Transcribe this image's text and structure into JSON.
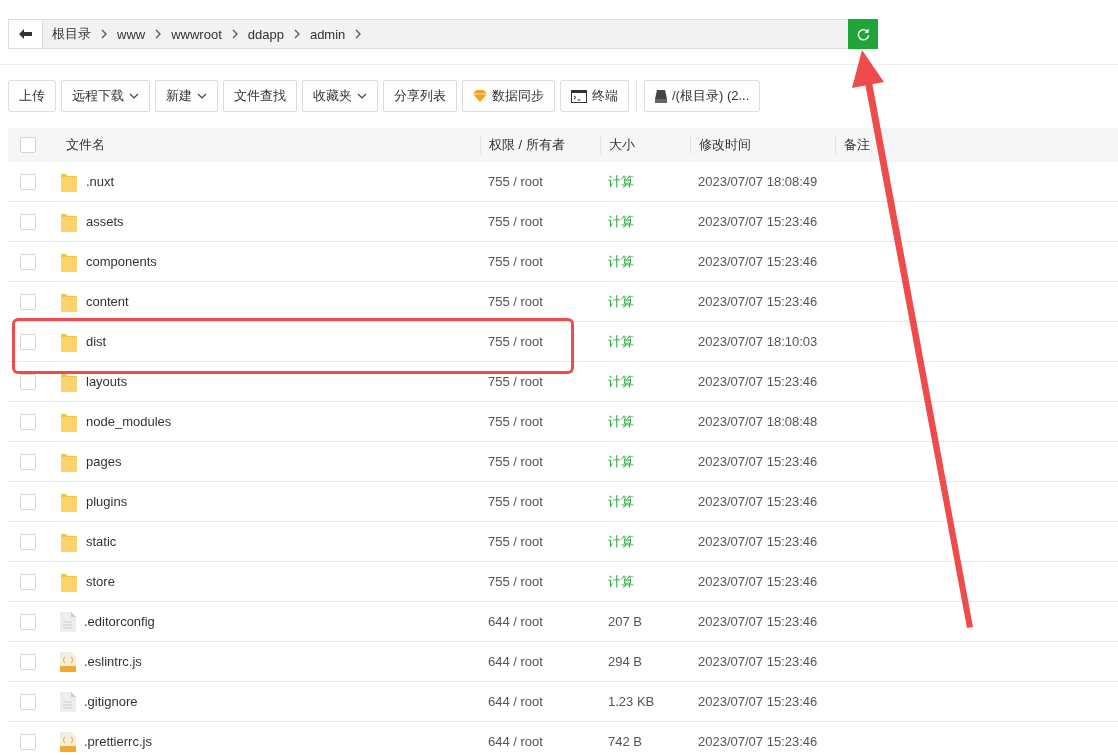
{
  "breadcrumb": {
    "items": [
      "根目录",
      "www",
      "wwwroot",
      "ddapp",
      "admin"
    ]
  },
  "toolbar": [
    {
      "kind": "plain",
      "label": "上传"
    },
    {
      "kind": "dropdown",
      "label": "远程下载"
    },
    {
      "kind": "dropdown",
      "label": "新建"
    },
    {
      "kind": "plain",
      "label": "文件查找"
    },
    {
      "kind": "dropdown",
      "label": "收藏夹"
    },
    {
      "kind": "plain",
      "label": "分享列表"
    },
    {
      "kind": "sync",
      "label": "数据同步"
    },
    {
      "kind": "terminal",
      "label": "终端"
    },
    {
      "kind": "disk",
      "label": "/(根目录) (2..."
    }
  ],
  "table": {
    "all_checked": false,
    "columns": [
      "文件名",
      "权限 / 所有者",
      "大小",
      "修改时间",
      "备注"
    ],
    "rows": [
      {
        "kind": "folder",
        "name": ".nuxt",
        "perm": "755 / root",
        "size": "计算",
        "time": "2023/07/07 18:08:49",
        "checked": false
      },
      {
        "kind": "folder",
        "name": "assets",
        "perm": "755 / root",
        "size": "计算",
        "time": "2023/07/07 15:23:46",
        "checked": false
      },
      {
        "kind": "folder",
        "name": "components",
        "perm": "755 / root",
        "size": "计算",
        "time": "2023/07/07 15:23:46",
        "checked": false
      },
      {
        "kind": "folder",
        "name": "content",
        "perm": "755 / root",
        "size": "计算",
        "time": "2023/07/07 15:23:46",
        "checked": false
      },
      {
        "kind": "folder",
        "name": "dist",
        "perm": "755 / root",
        "size": "计算",
        "time": "2023/07/07 18:10:03",
        "checked": false,
        "highlighted": true
      },
      {
        "kind": "folder",
        "name": "layouts",
        "perm": "755 / root",
        "size": "计算",
        "time": "2023/07/07 15:23:46",
        "checked": false
      },
      {
        "kind": "folder",
        "name": "node_modules",
        "perm": "755 / root",
        "size": "计算",
        "time": "2023/07/07 18:08:48",
        "checked": false
      },
      {
        "kind": "folder",
        "name": "pages",
        "perm": "755 / root",
        "size": "计算",
        "time": "2023/07/07 15:23:46",
        "checked": false
      },
      {
        "kind": "folder",
        "name": "plugins",
        "perm": "755 / root",
        "size": "计算",
        "time": "2023/07/07 15:23:46",
        "checked": false
      },
      {
        "kind": "folder",
        "name": "static",
        "perm": "755 / root",
        "size": "计算",
        "time": "2023/07/07 15:23:46",
        "checked": false
      },
      {
        "kind": "folder",
        "name": "store",
        "perm": "755 / root",
        "size": "计算",
        "time": "2023/07/07 15:23:46",
        "checked": false
      },
      {
        "kind": "text",
        "name": ".editorconfig",
        "perm": "644 / root",
        "size": "207 B",
        "time": "2023/07/07 15:23:46",
        "checked": false
      },
      {
        "kind": "js",
        "name": ".eslintrc.js",
        "perm": "644 / root",
        "size": "294 B",
        "time": "2023/07/07 15:23:46",
        "checked": false
      },
      {
        "kind": "text",
        "name": ".gitignore",
        "perm": "644 / root",
        "size": "1.23 KB",
        "time": "2023/07/07 15:23:46",
        "checked": false
      },
      {
        "kind": "js",
        "name": ".prettierrc.js",
        "perm": "644 / root",
        "size": "742 B",
        "time": "2023/07/07 15:23:46",
        "checked": false
      }
    ]
  }
}
